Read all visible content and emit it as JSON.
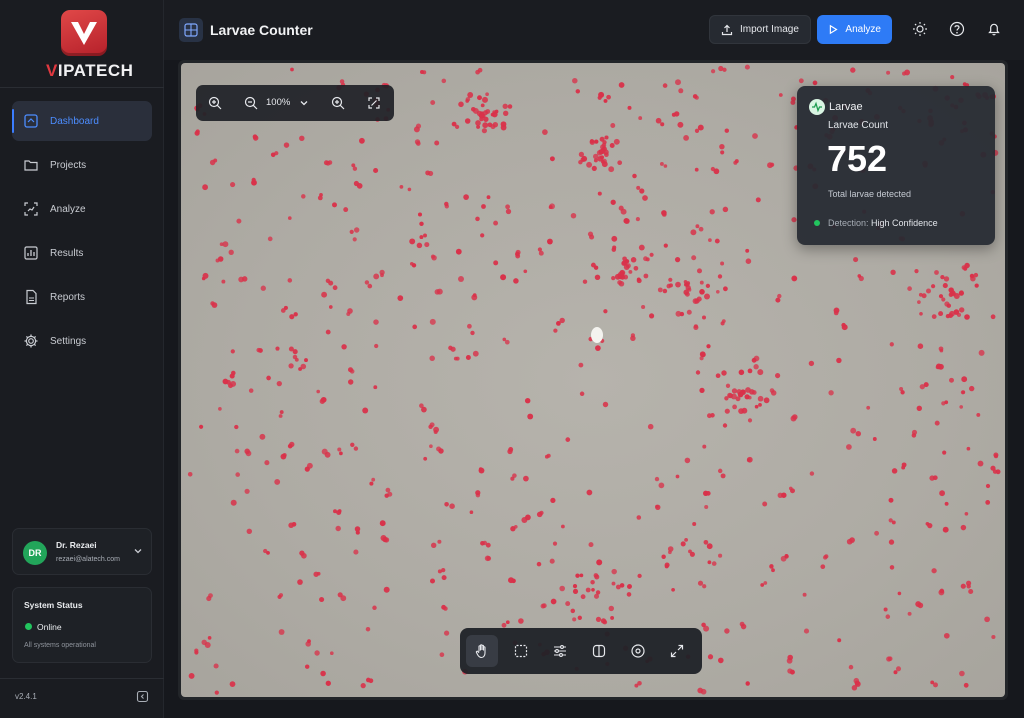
{
  "brand": {
    "name_prefix": "V",
    "name_rest": "IPATECH",
    "accent": "#e0383f"
  },
  "header": {
    "title": "Larvae Counter",
    "import_label": "Import Image",
    "analyze_label": "Analyze",
    "icons": [
      "theme-sun-icon",
      "help-icon",
      "notification-bell-icon"
    ]
  },
  "sidebar": {
    "items": [
      {
        "label": "Dashboard",
        "icon": "dashboard-icon",
        "active": true
      },
      {
        "label": "Projects",
        "icon": "folder-icon",
        "active": false
      },
      {
        "label": "Analyze",
        "icon": "analyze-icon",
        "active": false
      },
      {
        "label": "Results",
        "icon": "chart-icon",
        "active": false
      },
      {
        "label": "Reports",
        "icon": "report-icon",
        "active": false
      },
      {
        "label": "Settings",
        "icon": "gear-icon",
        "active": false
      }
    ],
    "user": {
      "initials": "DR",
      "name": "Dr. Rezaei",
      "email": "rezaei@alatech.com"
    },
    "system_status": {
      "title": "System Status",
      "value": "Online",
      "detail": "All systems operational"
    },
    "version": "v2.4.1"
  },
  "viewer": {
    "zoom": "100%",
    "result": {
      "label": "Larvae",
      "subtitle": "Larvae Count",
      "count": "752",
      "description": "Total larvae detected",
      "detection_prefix": "Detection:",
      "detection_value": "High Confidence"
    },
    "tools": [
      "pan-hand-icon",
      "select-rect-icon",
      "adjust-sliders-icon",
      "compare-icon",
      "target-icon",
      "fullscreen-icon"
    ]
  },
  "colors": {
    "accent_blue": "#2e7bf6",
    "status_green": "#22c55e",
    "marker_red": "#d9324a"
  }
}
